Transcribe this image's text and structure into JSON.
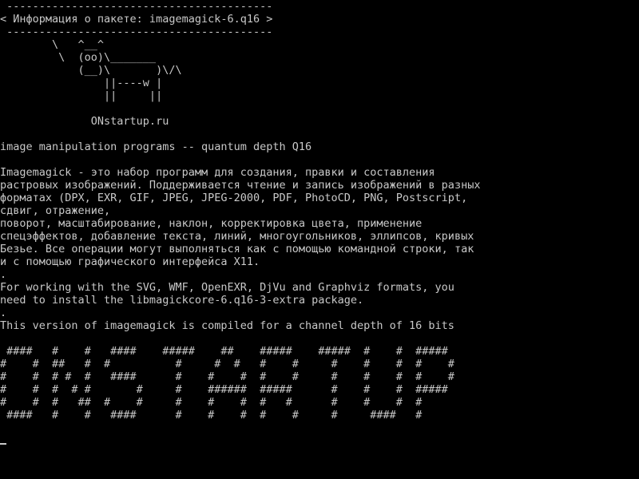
{
  "colors": {
    "background": "#000000",
    "text": "#c8c8c8"
  },
  "terminal": {
    "lines": [
      " -----------------------------------------",
      "< Информация о пакете: imagemagick-6.q16 >",
      " -----------------------------------------",
      "        \\   ^__^",
      "         \\  (oo)\\_______",
      "            (__)\\       )\\/\\",
      "                ||----w |",
      "                ||     ||",
      "",
      "              ONstartup.ru",
      "",
      "image manipulation programs -- quantum depth Q16",
      "",
      "Imagemagick - это набор программ для создания, правки и составления",
      "растровых изображений. Поддерживается чтение и запись изображений в разных",
      "форматах (DPX, EXR, GIF, JPEG, JPEG-2000, PDF, PhotoCD, PNG, Postscript,",
      "сдвиг, отражение,",
      "поворот, масштабирование, наклон, корректировка цвета, применение",
      "спецэффектов, добавление текста, линий, многоугольников, эллипсов, кривых",
      "Безье. Все операции могут выполняться как с помощью командной строки, так",
      "и с помощью графического интерфейса X11.",
      ".",
      "For working with the SVG, WMF, OpenEXR, DjVu and Graphviz formats, you",
      "need to install the libmagickcore-6.q16-3-extra package.",
      ".",
      "This version of imagemagick is compiled for a channel depth of 16 bits",
      "",
      " ####   #    #   ####    #####    ##    #####    #####  #    #  #####",
      "#    #  ##   #  #          #     #  #   #    #     #    #    #  #    #",
      "#    #  # #  #   ####      #    #    #  #    #     #    #    #  #    #",
      "#    #  #  # #       #     #    ######  #####      #    #    #  #####",
      "#    #  #   ##  #    #     #    #    #  #   #      #    #    #  #",
      " ####   #    #   ####      #    #    #  #    #     #     ####   #"
    ]
  }
}
